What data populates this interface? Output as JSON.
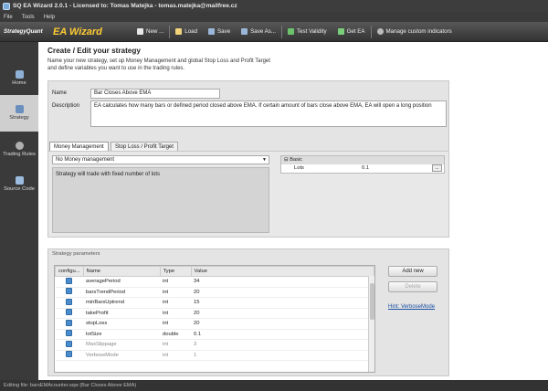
{
  "window": {
    "title": "SQ EA Wizard 2.0.1 - Licensed to: Tomas Matejka - tomas.matejka@mailfree.cz"
  },
  "menu": [
    "File",
    "Tools",
    "Help"
  ],
  "toolbar": {
    "logo": "StrategyQuant",
    "brand": "EA Wizard",
    "new": "New ...",
    "load": "Load",
    "save": "Save",
    "save_as": "Save As...",
    "test_validity": "Test Validity",
    "get_ea": "Get EA",
    "manage_indicators": "Manage custom indicators"
  },
  "sidebar": [
    {
      "label": "Home",
      "icon": "home-icon"
    },
    {
      "label": "Strategy",
      "icon": "strategy-icon"
    },
    {
      "label": "Trading Rules",
      "icon": "rules-icon"
    },
    {
      "label": "Source Code",
      "icon": "code-icon"
    }
  ],
  "header": {
    "title": "Create / Edit your strategy",
    "desc1": "Name your new strategy, set up Money Management and global Stop Loss and Profit Target",
    "desc2": "and define variables you want to use in the trading rules."
  },
  "form": {
    "name_label": "Name",
    "name_value": "Bar Closes Above EMA",
    "desc_label": "Description",
    "desc_value": "EA calculates how many bars or defined period closed above EMA. If certain amount of bars close above EMA, EA will open a long position"
  },
  "tabs": [
    "Money Management",
    "Stop Loss / Profit Target"
  ],
  "mm": {
    "select": "No Money management",
    "note": "Strategy will trade with fixed number of lots",
    "basic_label": "Basic",
    "lots_label": "Lots",
    "lots_value": "0.1",
    "ellipsis": "..."
  },
  "params": {
    "section_label": "Strategy parameters",
    "columns": [
      "configu...",
      "Name",
      "Type",
      "Value"
    ],
    "rows": [
      {
        "name": "averagePeriod",
        "type": "int",
        "value": "34",
        "checked": true,
        "dim": false
      },
      {
        "name": "barsTrendPeriod",
        "type": "int",
        "value": "20",
        "checked": true,
        "dim": false
      },
      {
        "name": "minBarsUptrend",
        "type": "int",
        "value": "15",
        "checked": true,
        "dim": false
      },
      {
        "name": "takeProfit",
        "type": "int",
        "value": "20",
        "checked": true,
        "dim": false
      },
      {
        "name": "stopLoss",
        "type": "int",
        "value": "20",
        "checked": true,
        "dim": false
      },
      {
        "name": "lotSize",
        "type": "double",
        "value": "0.1",
        "checked": true,
        "dim": false
      },
      {
        "name": "MaxSlippage",
        "type": "int",
        "value": "3",
        "checked": true,
        "dim": true
      },
      {
        "name": "VerboseMode",
        "type": "int",
        "value": "1",
        "checked": true,
        "dim": true
      }
    ],
    "add_label": "Add new",
    "delete_label": "Delete",
    "hint": "Hint: VerboseMode"
  },
  "status": "Editing file: barsEMAcounter.sqw (Bar Closes Above EMA)",
  "colors": {
    "accent": "#ffcc33",
    "check": "#4a8ccc",
    "link": "#1a4fa0"
  }
}
